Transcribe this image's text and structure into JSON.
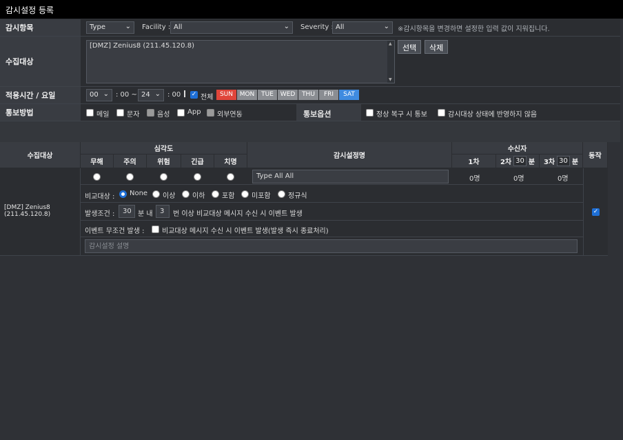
{
  "window": {
    "title": "감시설정 등록"
  },
  "monitor_item": {
    "label": "감시항목",
    "type_value": "Type",
    "facility_label": "Facility :",
    "facility_value": "All",
    "severity_label": "Severity :",
    "severity_value": "All",
    "note": "※감시항목을 변경하면 설정한 입력 값이 지워집니다."
  },
  "target": {
    "label": "수집대상",
    "list_item": "[DMZ] Zenius8 (211.45.120.8)",
    "select_button": "선택",
    "delete_button": "삭제"
  },
  "schedule": {
    "label": "적용시간 / 요일",
    "start_hour": "00",
    "start_sep": ": 00 ~",
    "end_hour": "24",
    "end_sep": ": 00",
    "all_label": "전체",
    "days": [
      {
        "label": "SUN",
        "color": "#e0453a"
      },
      {
        "label": "MON",
        "color": "#8a8d92"
      },
      {
        "label": "TUE",
        "color": "#8a8d92"
      },
      {
        "label": "WED",
        "color": "#8a8d92"
      },
      {
        "label": "THU",
        "color": "#8a8d92"
      },
      {
        "label": "FRI",
        "color": "#8a8d92"
      },
      {
        "label": "SAT",
        "color": "#3f8be0"
      }
    ]
  },
  "notify": {
    "method_label": "통보방법",
    "methods": [
      "메일",
      "문자",
      "음성",
      "App",
      "외부연동"
    ],
    "option_label": "통보옵션",
    "option_recover": "정상 복구 시 통보",
    "option_ignore": "감시대상 상태에 반영하지 않음"
  },
  "table": {
    "col_target": "수집대상",
    "col_severity": "심각도",
    "severities": [
      "무해",
      "주의",
      "위험",
      "긴급",
      "치명"
    ],
    "col_name": "감시설정명",
    "col_receiver": "수신자",
    "recv_1": "1차",
    "recv_2": "2차",
    "recv_2_val": "30",
    "recv_3": "3차",
    "recv_3_val": "30",
    "minute_unit": "분",
    "col_action": "동작",
    "row": {
      "target": "[DMZ] Zenius8 (211.45.120.8)",
      "name_value": "Type All All",
      "count_1": "0명",
      "count_2": "0명",
      "count_3": "0명",
      "compare_label": "비교대상 :",
      "compare_options": [
        "None",
        "이상",
        "이하",
        "포함",
        "미포함",
        "정규식"
      ],
      "cond_label": "발생조건 :",
      "cond_minutes": "30",
      "cond_mid": "분 내",
      "cond_count": "3",
      "cond_tail": "번 이상 비교대상 메시지 수신 시 이벤트 발생",
      "uncond_label": "이벤트 무조건 발생 :",
      "uncond_text": "비교대상 메시지 수신 시 이벤트 발생(발생 즉시 종료처리)",
      "desc_placeholder": "감시설정 설명"
    }
  }
}
